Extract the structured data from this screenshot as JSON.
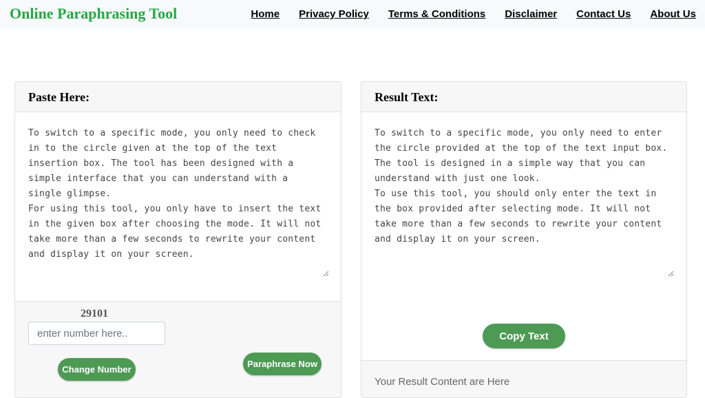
{
  "header": {
    "brand": "Online Paraphrasing Tool",
    "nav": [
      "Home",
      "Privacy Policy",
      "Terms & Conditions",
      "Disclaimer",
      "Contact Us",
      "About Us"
    ]
  },
  "input_card": {
    "title": "Paste Here:",
    "text": "To switch to a specific mode, you only need to check\nin to the circle given at the top of the text\ninsertion box. The tool has been designed with a\nsimple interface that you can understand with a\nsingle glimpse.\nFor using this tool, you only have to insert the text\nin the given box after choosing the mode. It will not\ntake more than a few seconds to rewrite your content\nand display it on your screen.",
    "captcha_number": "29101",
    "number_placeholder": "enter number here..",
    "change_label": "Change Number",
    "paraphrase_label": "Paraphrase Now"
  },
  "result_card": {
    "title": "Result Text:",
    "text": "To switch to a specific mode, you only need to enter\nthe circle provided at the top of the text input box.\nThe tool is designed in a simple way that you can\nunderstand with just one look.\nTo use this tool, you should only enter the text in\nthe box provided after selecting mode. It will not\ntake more than a few seconds to rewrite your content\nand display it on your screen.",
    "copy_label": "Copy Text",
    "footer_text": "Your Result Content are Here"
  },
  "colors": {
    "brand_green": "#28a745",
    "button_green": "#4d9a55"
  }
}
